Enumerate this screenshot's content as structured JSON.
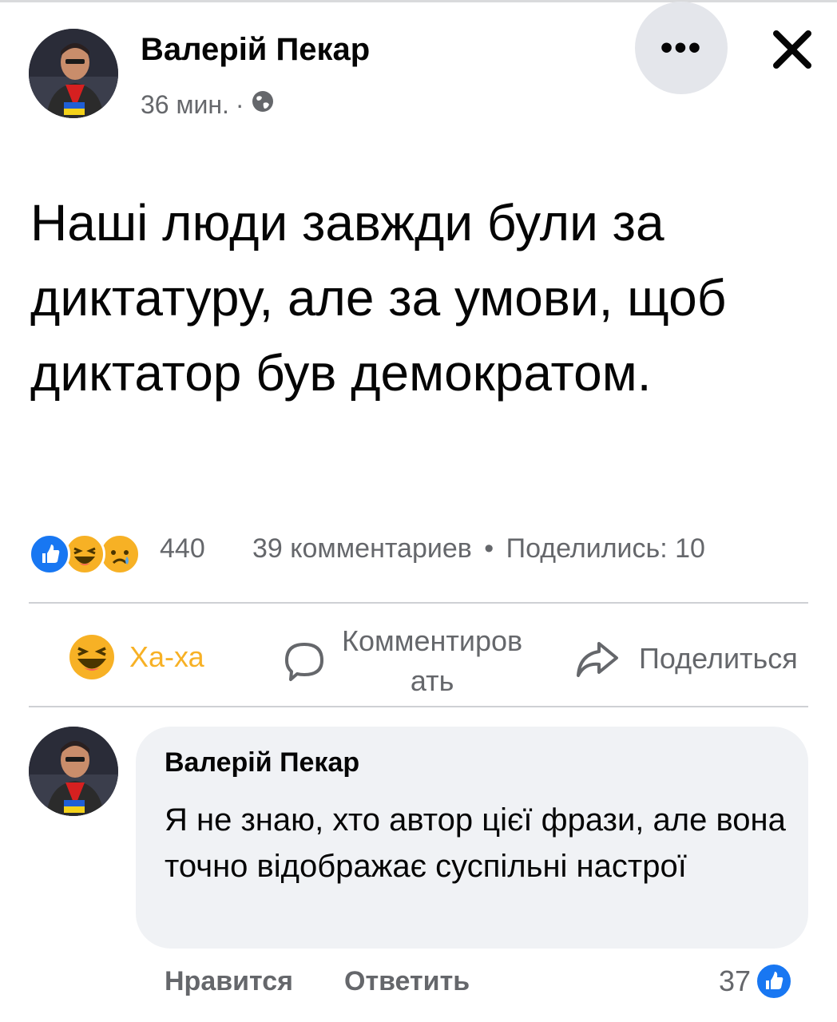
{
  "post": {
    "author": "Валерій Пекар",
    "time": "36 мин.",
    "separator": "·",
    "privacy_icon": "globe-icon",
    "text": "Наші люди завжди були за диктатуру, але за умови, щоб диктатор був демократом.",
    "more_icon": "more-dots-icon",
    "more_label": "•••",
    "close_icon": "close-icon"
  },
  "stats": {
    "reaction_icons": [
      "like-reaction-icon",
      "haha-reaction-icon",
      "sad-reaction-icon"
    ],
    "reactions_count": "440",
    "comments": "39 комментариев",
    "dot": "•",
    "shares": "Поделились: 10"
  },
  "actions": {
    "haha": "Ха-ха",
    "comment": "Комментиров\nать",
    "share": "Поделиться"
  },
  "comment": {
    "author": "Валерій Пекар",
    "text": "Я не знаю, хто автор цієї фрази, але вона точно відображає суспільні настрої",
    "like": "Нравится",
    "reply": "Ответить",
    "likes_count": "37"
  },
  "colors": {
    "facebook_blue": "#1877f2",
    "secondary_text": "#65676b",
    "bubble": "#f0f2f5",
    "haha_yellow": "#f7b125"
  }
}
